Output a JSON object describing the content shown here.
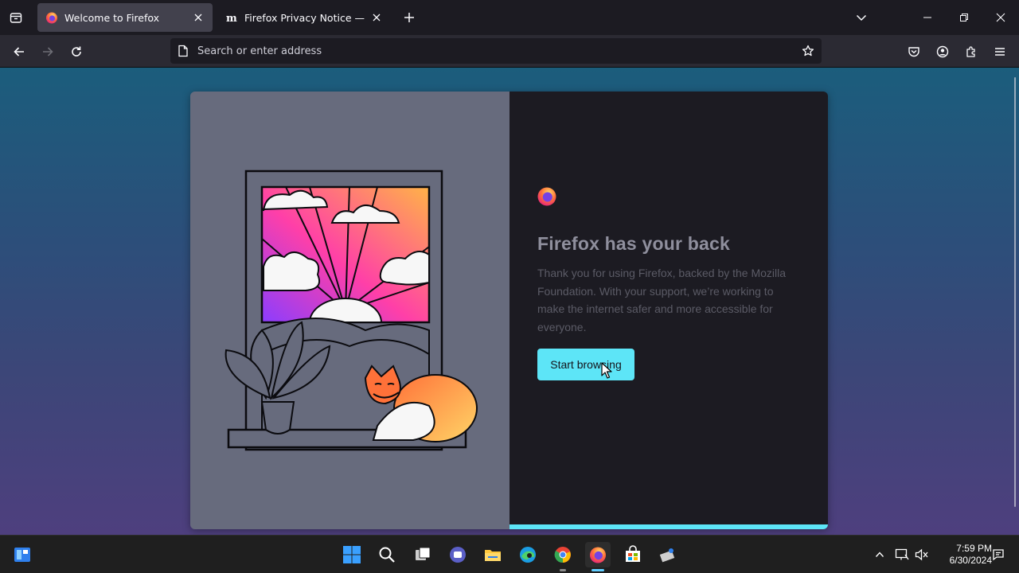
{
  "browser": {
    "tabs": [
      {
        "title": "Welcome to Firefox",
        "active": true,
        "favicon": "firefox-icon"
      },
      {
        "title": "Firefox Privacy Notice — Mozilla",
        "active": false,
        "favicon": "mozilla-m-icon"
      }
    ],
    "urlbar": {
      "placeholder": "Search or enter address",
      "value": ""
    },
    "accent_color": "#5de5f7"
  },
  "welcome": {
    "headline": "Firefox has your back",
    "body": "Thank you for using Firefox, backed by the Mozilla Foundation. With your support, we’re working to make the internet safer and more accessible for everyone.",
    "cta_label": "Start browsing",
    "progress": 1.0
  },
  "taskbar": {
    "apps": [
      "widgets-icon",
      "start-icon",
      "search-icon",
      "task-view-icon",
      "teams-chat-icon",
      "file-explorer-icon",
      "edge-icon",
      "chrome-icon",
      "firefox-icon",
      "store-icon",
      "app-icon"
    ],
    "clock": {
      "time": "7:59 PM",
      "date": "6/30/2024"
    }
  }
}
